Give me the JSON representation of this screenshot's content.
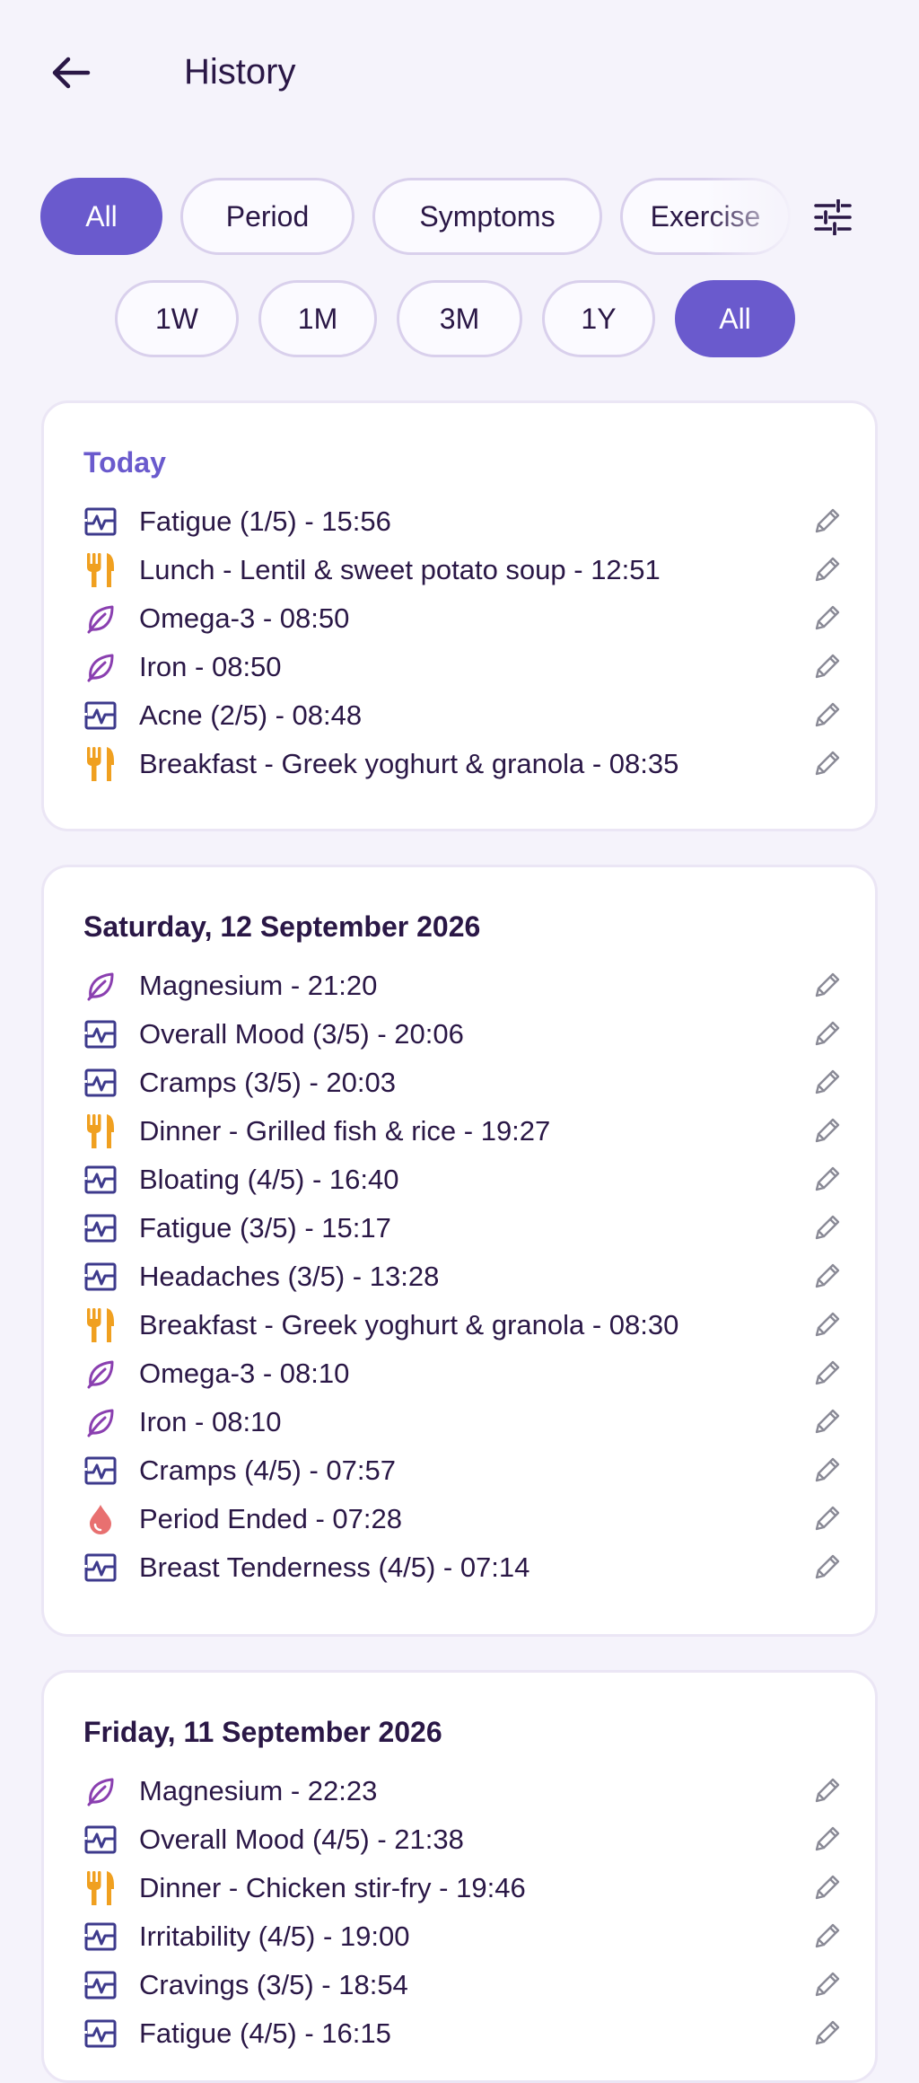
{
  "header": {
    "title": "History"
  },
  "category_chips": [
    {
      "label": "All",
      "active": true
    },
    {
      "label": "Period",
      "active": false
    },
    {
      "label": "Symptoms",
      "active": false
    },
    {
      "label": "Exercise",
      "active": false
    }
  ],
  "range_chips": [
    {
      "label": "1W",
      "active": false
    },
    {
      "label": "1M",
      "active": false
    },
    {
      "label": "3M",
      "active": false
    },
    {
      "label": "1Y",
      "active": false
    },
    {
      "label": "All",
      "active": true
    }
  ],
  "colors": {
    "accent": "#6a5acd",
    "symptom_icon": "#3d3a8c",
    "meal_icon": "#f0a020",
    "supplement_icon": "#8a3fb0",
    "period_icon": "#e87070"
  },
  "days": [
    {
      "title": "Today",
      "entries": [
        {
          "icon": "symptom-icon",
          "text": "Fatigue (1/5) - 15:56"
        },
        {
          "icon": "meal-icon",
          "text": "Lunch - Lentil & sweet potato soup - 12:51"
        },
        {
          "icon": "supplement-icon",
          "text": "Omega-3 - 08:50"
        },
        {
          "icon": "supplement-icon",
          "text": "Iron - 08:50"
        },
        {
          "icon": "symptom-icon",
          "text": "Acne (2/5) - 08:48"
        },
        {
          "icon": "meal-icon",
          "text": "Breakfast - Greek yoghurt & granola - 08:35"
        }
      ]
    },
    {
      "title": "Saturday, 12 September 2026",
      "entries": [
        {
          "icon": "supplement-icon",
          "text": "Magnesium - 21:20"
        },
        {
          "icon": "symptom-icon",
          "text": "Overall Mood (3/5) - 20:06"
        },
        {
          "icon": "symptom-icon",
          "text": "Cramps (3/5) - 20:03"
        },
        {
          "icon": "meal-icon",
          "text": "Dinner - Grilled fish & rice - 19:27"
        },
        {
          "icon": "symptom-icon",
          "text": "Bloating (4/5) - 16:40"
        },
        {
          "icon": "symptom-icon",
          "text": "Fatigue (3/5) - 15:17"
        },
        {
          "icon": "symptom-icon",
          "text": "Headaches (3/5) - 13:28"
        },
        {
          "icon": "meal-icon",
          "text": "Breakfast - Greek yoghurt & granola - 08:30"
        },
        {
          "icon": "supplement-icon",
          "text": "Omega-3 - 08:10"
        },
        {
          "icon": "supplement-icon",
          "text": "Iron - 08:10"
        },
        {
          "icon": "symptom-icon",
          "text": "Cramps (4/5) - 07:57"
        },
        {
          "icon": "period-icon",
          "text": "Period Ended - 07:28"
        },
        {
          "icon": "symptom-icon",
          "text": "Breast Tenderness (4/5) - 07:14"
        }
      ]
    },
    {
      "title": "Friday, 11 September 2026",
      "entries": [
        {
          "icon": "supplement-icon",
          "text": "Magnesium - 22:23"
        },
        {
          "icon": "symptom-icon",
          "text": "Overall Mood (4/5) - 21:38"
        },
        {
          "icon": "meal-icon",
          "text": "Dinner - Chicken stir-fry - 19:46"
        },
        {
          "icon": "symptom-icon",
          "text": "Irritability (4/5) - 19:00"
        },
        {
          "icon": "symptom-icon",
          "text": "Cravings (3/5) - 18:54"
        },
        {
          "icon": "symptom-icon",
          "text": "Fatigue (4/5) - 16:15"
        }
      ]
    }
  ]
}
